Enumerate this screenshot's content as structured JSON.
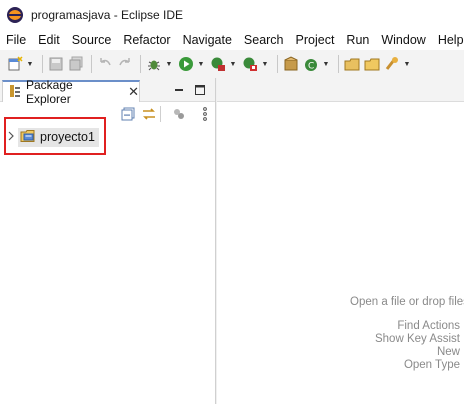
{
  "window": {
    "title": "programasjava - Eclipse IDE"
  },
  "menu": [
    "File",
    "Edit",
    "Source",
    "Refactor",
    "Navigate",
    "Search",
    "Project",
    "Run",
    "Window",
    "Help"
  ],
  "toolbar": {
    "icons": [
      "new-icon",
      "save-icon",
      "save-all-icon",
      "undo-icon",
      "redo-icon",
      "debug-icon",
      "run-icon",
      "coverage-icon",
      "external-tools-icon",
      "new-java-package-icon",
      "new-java-class-icon",
      "open-type-icon",
      "open-folder-icon",
      "search-icon"
    ]
  },
  "package_explorer": {
    "tab_label": "Package Explorer",
    "close_glyph": "✕",
    "tree": [
      {
        "label": "proyecto1",
        "expanded": false,
        "selected": true
      }
    ]
  },
  "editor_hints": {
    "main": "Open a file or drop files",
    "items": [
      "Find Actions",
      "Show Key Assist",
      "New",
      "Open Type"
    ]
  },
  "colors": {
    "selection_outline": "#e02020",
    "tab_accent": "#6b8fc9",
    "hint_text": "#8a8a8a"
  }
}
